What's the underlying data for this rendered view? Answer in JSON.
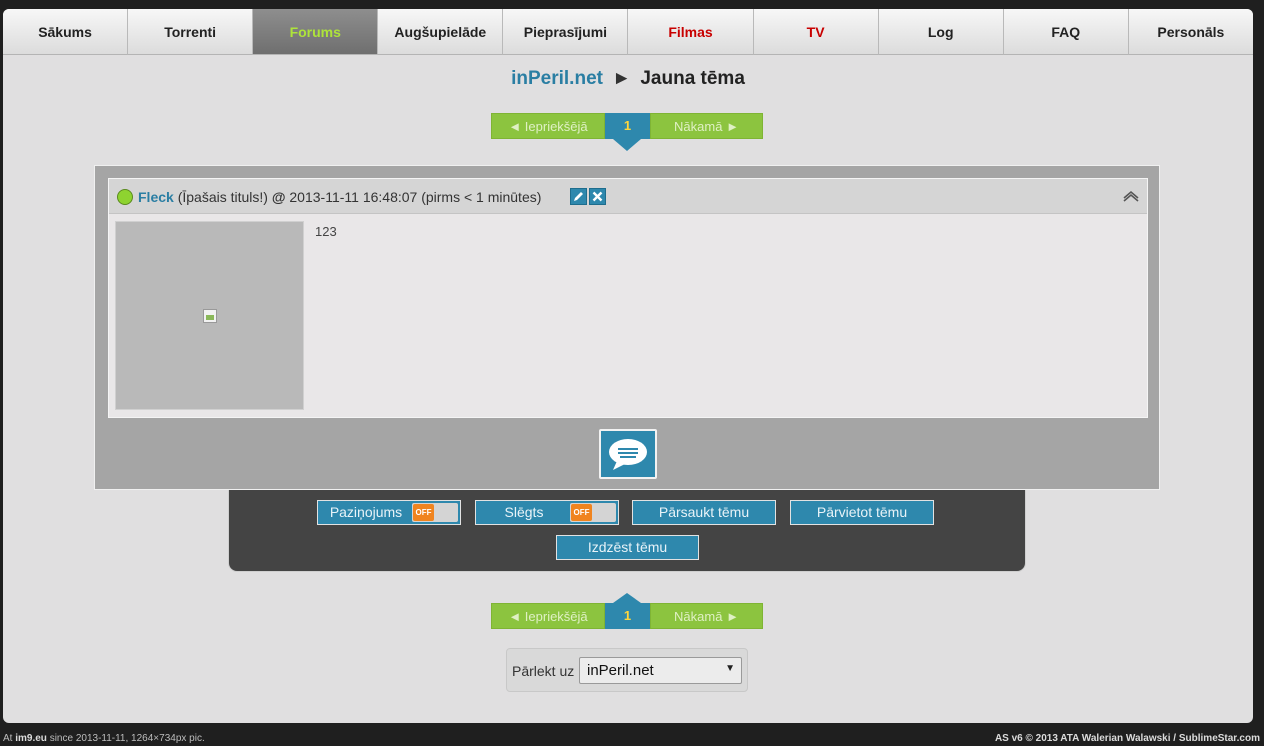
{
  "nav": {
    "items": [
      {
        "label": "Sākums"
      },
      {
        "label": "Torrenti"
      },
      {
        "label": "Forums"
      },
      {
        "label": "Augšupielāde"
      },
      {
        "label": "Pieprasījumi"
      },
      {
        "label": "Filmas"
      },
      {
        "label": "TV"
      },
      {
        "label": "Log"
      },
      {
        "label": "FAQ"
      },
      {
        "label": "Personāls"
      }
    ],
    "active": "Forums",
    "highlight_color": "#c80000"
  },
  "breadcrumb": {
    "site": "inPeril.net",
    "separator": "►",
    "topic": "Jauna tēma"
  },
  "pagination": {
    "prev_label": "◄ Iepriekšējā",
    "current": "1",
    "next_label": "Nākamā ►"
  },
  "post": {
    "author": "Fleck",
    "title": "(Īpašais tituls!)",
    "at": "@",
    "timestamp": "2013-11-11 16:48:07",
    "relative_time": "(pirms < 1 minūtes)",
    "body": "123",
    "online_status_color": "#8ed330"
  },
  "moderation": {
    "announce_label": "Paziņojums",
    "announce_state": "OFF",
    "lock_label": "Slēgts",
    "lock_state": "OFF",
    "rename_label": "Pārsaukt tēmu",
    "move_label": "Pārvietot tēmu",
    "delete_label": "Izdzēst tēmu"
  },
  "jump": {
    "label": "Pārlekt uz",
    "selected": "inPeril.net"
  },
  "footer": {
    "left_prefix": "At",
    "left_site": "im9.eu",
    "left_rest": "since 2013-11-11, 1264×734px pic.",
    "right": "AS v6 © 2013 ATA Walerian Walawski / SublimeStar.com"
  },
  "colors": {
    "accent_blue": "#2e88ad",
    "pager_green": "#8cc43f",
    "active_nav_text": "#aee43a",
    "toggle_orange": "#f0841f"
  }
}
